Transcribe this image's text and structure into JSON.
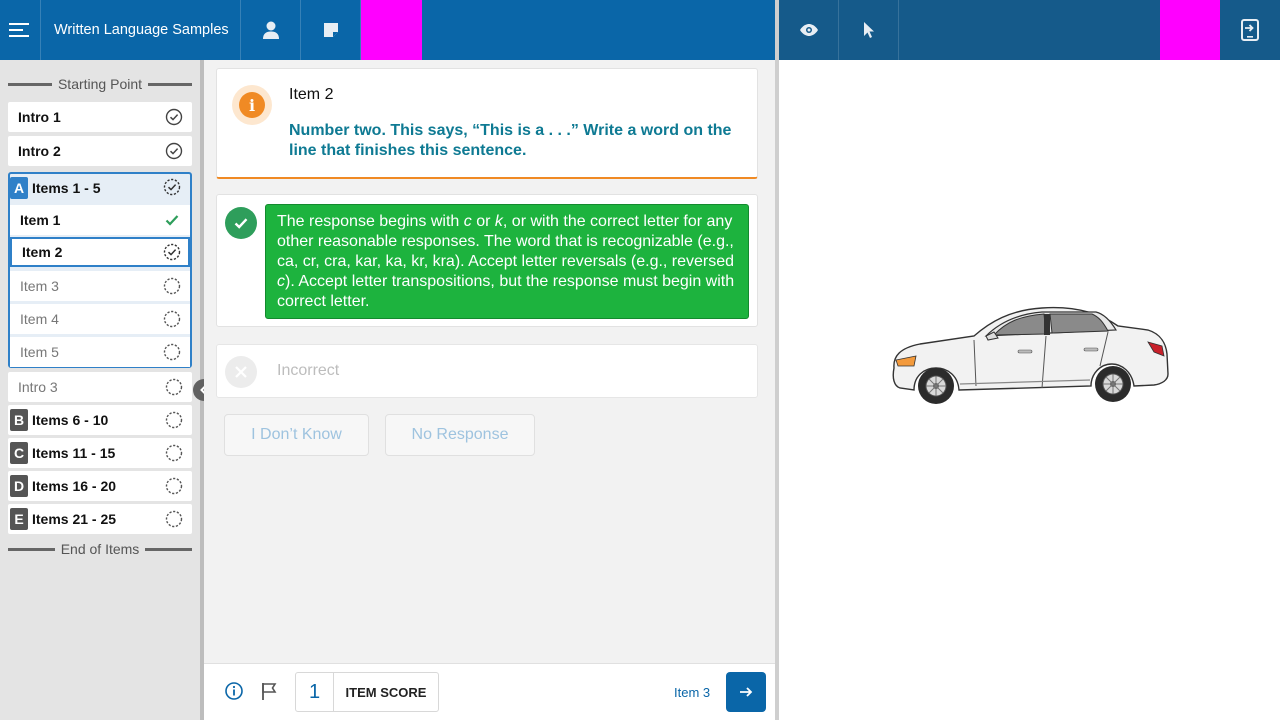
{
  "header": {
    "title": "Written Language Samples"
  },
  "sidebar": {
    "start_label": "Starting Point",
    "end_label": "End of Items",
    "items": [
      {
        "label": "Intro 1",
        "status": "complete"
      },
      {
        "label": "Intro 2",
        "status": "complete"
      },
      {
        "letter": "A",
        "label": "Items 1 - 5",
        "status": "in-progress"
      },
      {
        "label": "Item 1",
        "status": "scored"
      },
      {
        "label": "Item 2",
        "status": "in-progress"
      },
      {
        "label": "Item 3",
        "status": "not-started"
      },
      {
        "label": "Item 4",
        "status": "not-started"
      },
      {
        "label": "Item 5",
        "status": "not-started"
      },
      {
        "label": "Intro 3",
        "status": "not-started"
      },
      {
        "letter": "B",
        "label": "Items 6 - 10",
        "status": "not-started"
      },
      {
        "letter": "C",
        "label": "Items 11 - 15",
        "status": "not-started"
      },
      {
        "letter": "D",
        "label": "Items 16 - 20",
        "status": "not-started"
      },
      {
        "letter": "E",
        "label": "Items 21 - 25",
        "status": "not-started"
      }
    ]
  },
  "prompt": {
    "title": "Item 2",
    "text": "Number two. This says, “This is a . . .” Write a word on the line that finishes this sentence."
  },
  "correct": {
    "text_parts": {
      "a": "The response begins with ",
      "c": "c",
      "b": " or ",
      "k": "k",
      "rest": ", or with the correct letter for any other reasonable responses. The word that is recognizable (e.g., ca, cr, cra, kar, ka, kr, kra). Accept letter reversals (e.g., reversed ",
      "c2": "c",
      "end": "). Accept letter transpositions, but the response must begin with correct letter."
    }
  },
  "incorrect": {
    "label": "Incorrect"
  },
  "buttons": {
    "dont_know": "I Don’t Know",
    "no_response": "No Response"
  },
  "footer": {
    "score_value": "1",
    "score_label": "ITEM SCORE",
    "next_label": "Item 3"
  },
  "colors": {
    "primary": "#0a66a8",
    "secondary": "#155a8a",
    "accent_magenta": "#ff00ff",
    "correct_green": "#1db33e",
    "warning_orange": "#f08a24"
  }
}
